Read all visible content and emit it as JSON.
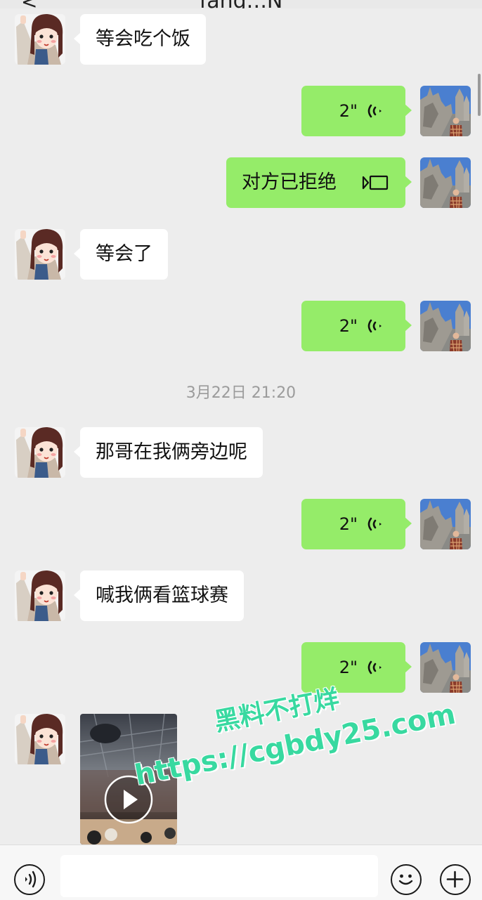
{
  "header": {
    "back_icon": "chevron-left-icon",
    "title": "fang.:.N"
  },
  "colors": {
    "outgoing_bubble": "#95ec69",
    "incoming_bubble": "#ffffff",
    "background": "#ededed"
  },
  "messages": [
    {
      "from": "them",
      "type": "text",
      "text": "等会吃个饭"
    },
    {
      "from": "me",
      "type": "voice",
      "duration": "2\""
    },
    {
      "from": "me",
      "type": "call",
      "text": "对方已拒绝"
    },
    {
      "from": "them",
      "type": "text",
      "text": "等会了"
    },
    {
      "from": "me",
      "type": "voice",
      "duration": "2\""
    },
    {
      "from": "system",
      "type": "timestamp",
      "text": "3月22日 21:20"
    },
    {
      "from": "them",
      "type": "text",
      "text": "那哥在我俩旁边呢"
    },
    {
      "from": "me",
      "type": "voice",
      "duration": "2\""
    },
    {
      "from": "them",
      "type": "text",
      "text": "喊我俩看篮球赛"
    },
    {
      "from": "me",
      "type": "voice",
      "duration": "2\""
    },
    {
      "from": "them",
      "type": "video",
      "icon": "play-icon"
    }
  ],
  "watermark": {
    "line1": "黑料不打烊",
    "line2": "https://cgbdy25.com"
  },
  "input_bar": {
    "placeholder": "",
    "voice_icon": "voice-mode-icon",
    "emoji_icon": "emoji-icon",
    "plus_icon": "plus-icon"
  }
}
